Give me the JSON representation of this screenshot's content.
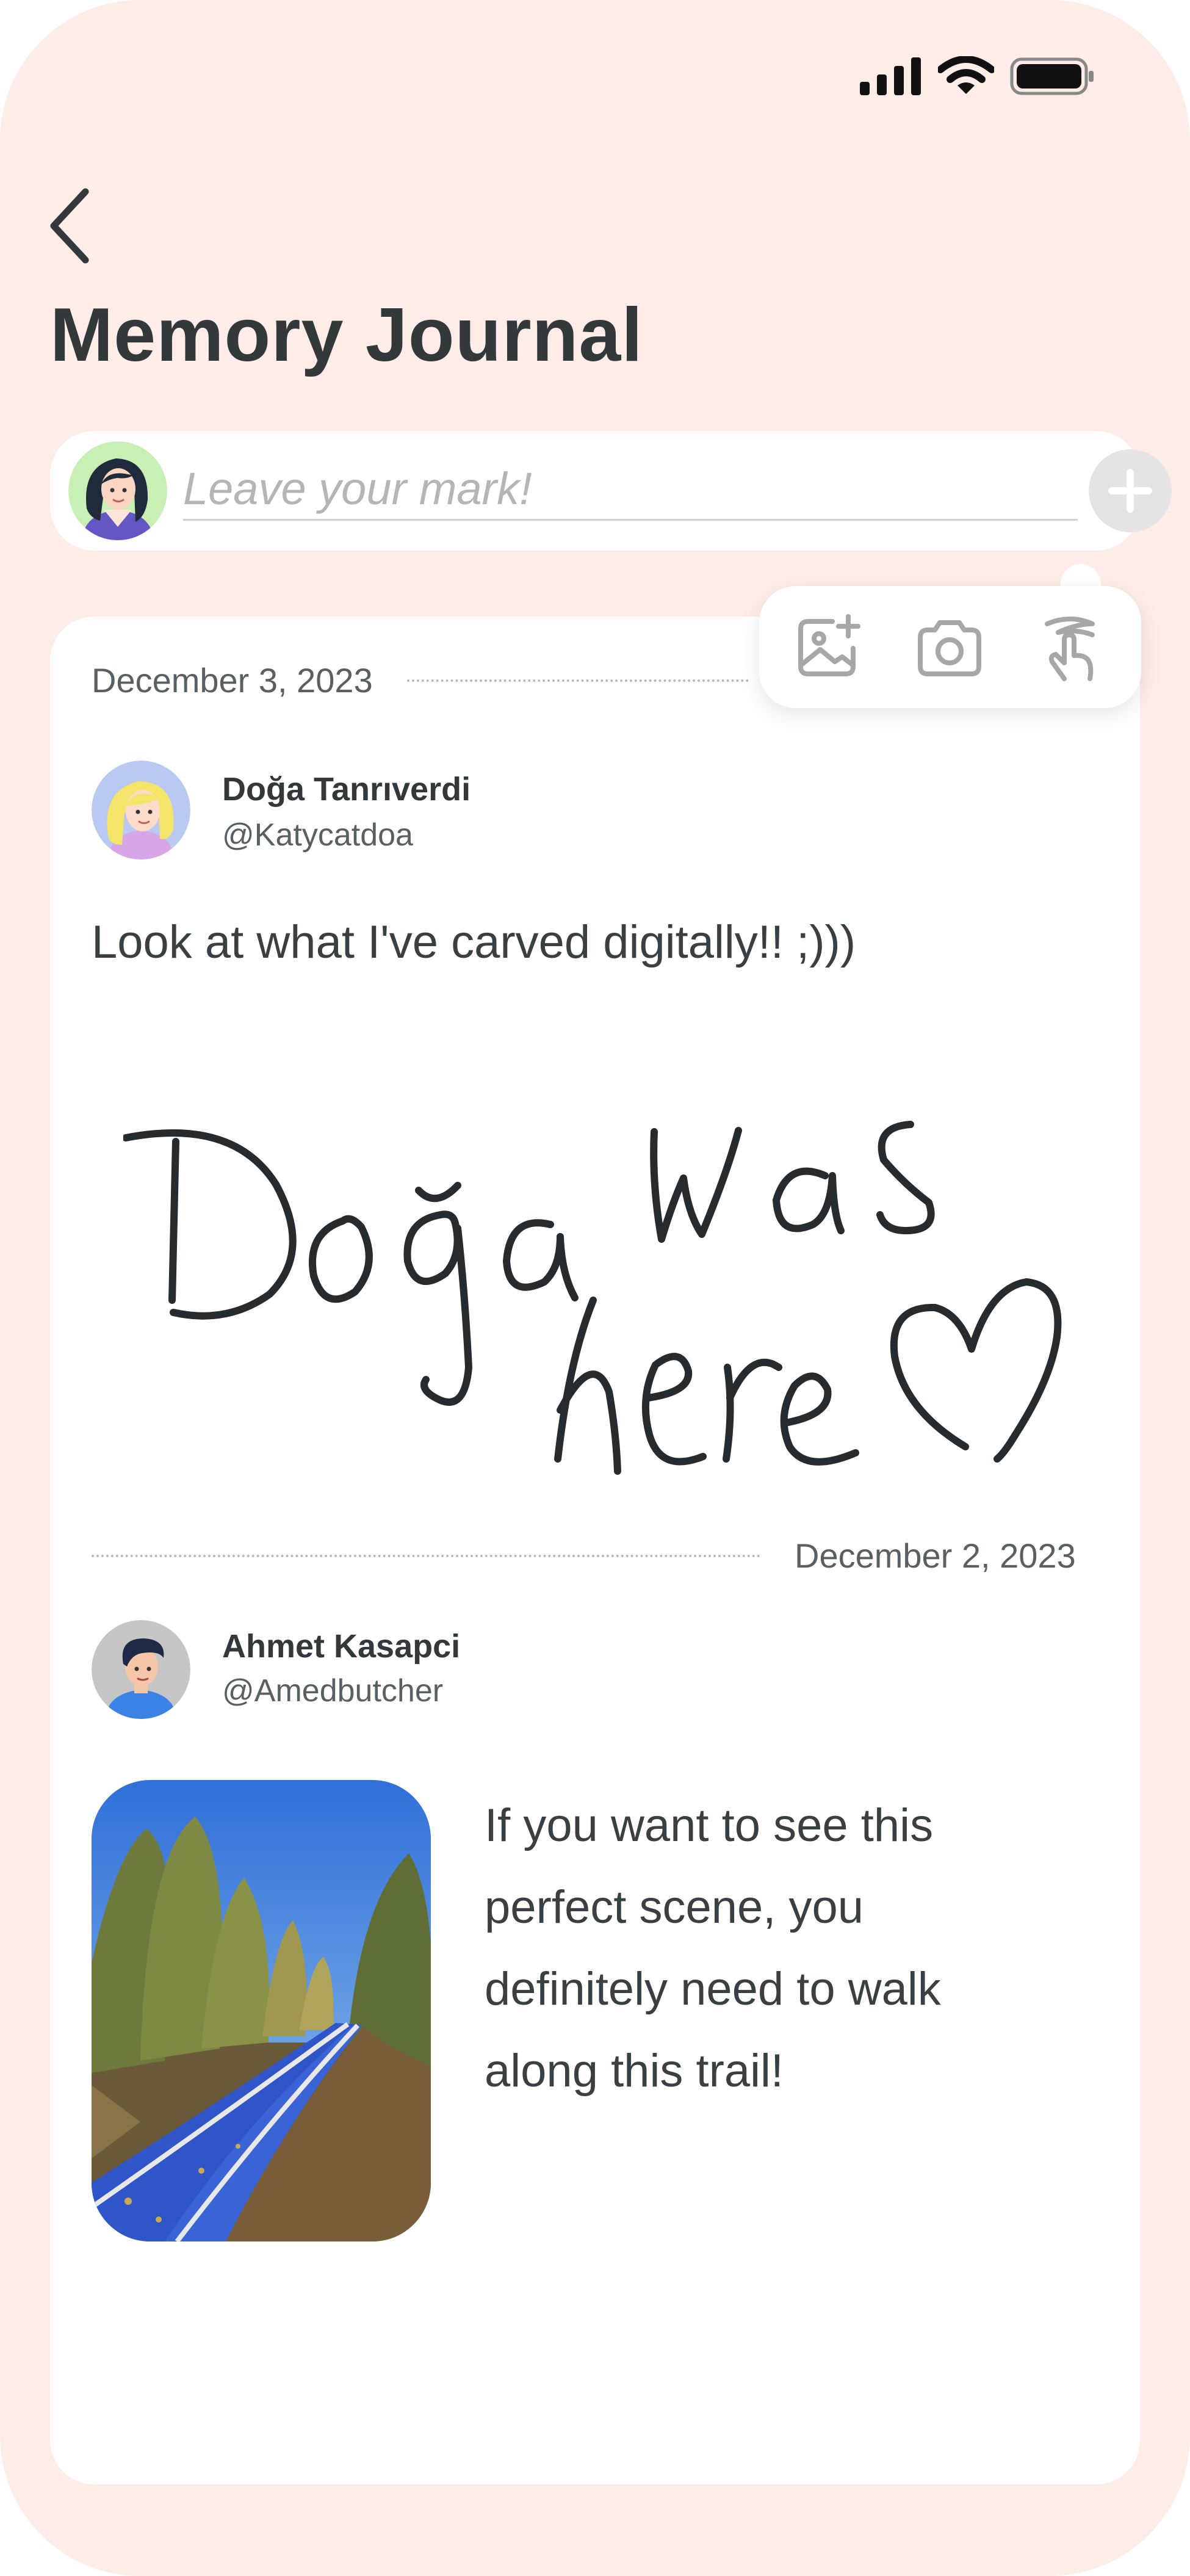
{
  "app": {
    "title": "Memory Journal"
  },
  "status_bar": {
    "icons": [
      "signal-icon",
      "wifi-icon",
      "battery-icon"
    ]
  },
  "composer": {
    "placeholder": "Leave your mark!",
    "value": "",
    "add_icon": "plus-icon"
  },
  "attach_menu": {
    "items": [
      "add-image-icon",
      "camera-icon",
      "draw-gesture-icon"
    ]
  },
  "posts": [
    {
      "date": "December 3, 2023",
      "author": "Doğa Tanrıverdi",
      "handle": "@Katycatdoa",
      "text": "Look at what I've carved digitally!! ;)))",
      "drawing_words": [
        "Doğa",
        "was",
        "here"
      ]
    },
    {
      "date": "December 2, 2023",
      "author": "Ahmet Kasapci",
      "handle": "@Amedbutcher",
      "text": "If you want to see this perfect scene, you definitely need to walk along this trail!"
    }
  ],
  "colors": {
    "background": "#fdece7",
    "card": "#ffffff",
    "text": "#33383b",
    "ink": "#262b2f",
    "muted": "#b5b5b5"
  }
}
